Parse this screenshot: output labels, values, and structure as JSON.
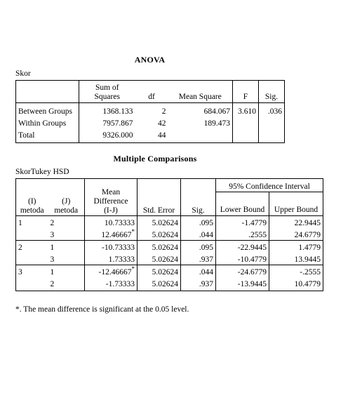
{
  "document": {
    "background": "#ffffff",
    "text_color": "#000000"
  },
  "anova": {
    "title": "ANOVA",
    "caption": "Skor",
    "columns": [
      "",
      "Sum of\nSquares",
      "df",
      "Mean Square",
      "F",
      "Sig."
    ],
    "column_labels": {
      "row_header": "",
      "sum_of_squares_line1": "Sum of",
      "sum_of_squares_line2": "Squares",
      "df": "df",
      "mean_square": "Mean Square",
      "f": "F",
      "sig": "Sig."
    },
    "rows": [
      {
        "source": "Between Groups",
        "sum_of_squares": "1368.133",
        "df": "2",
        "mean_square": "684.067",
        "f": "3.610",
        "sig": ".036"
      },
      {
        "source": "Within Groups",
        "sum_of_squares": "7957.867",
        "df": "42",
        "mean_square": "189.473",
        "f": "",
        "sig": ""
      },
      {
        "source": "Total",
        "sum_of_squares": "9326.000",
        "df": "44",
        "mean_square": "",
        "f": "",
        "sig": ""
      }
    ]
  },
  "multiple_comparisons": {
    "title": "Multiple Comparisons",
    "caption": "SkorTukey HSD",
    "headers": {
      "i_metoda_line1": "(I)",
      "i_metoda_line2": "metoda",
      "j_metoda_line1": "(J)",
      "j_metoda_line2": "metoda",
      "mean_difference_line1": "Mean",
      "mean_difference_line2": "Difference",
      "mean_difference_line3": "(I-J)",
      "std_error": "Std. Error",
      "sig": "Sig.",
      "confidence_interval": "95% Confidence Interval",
      "lower_bound": "Lower Bound",
      "upper_bound": "Upper Bound"
    },
    "groups": [
      {
        "i_metoda": "1",
        "rows": [
          {
            "j_metoda": "2",
            "mean_difference": "10.73333",
            "significant": false,
            "std_error": "5.02624",
            "sig": ".095",
            "lower_bound": "-1.4779",
            "upper_bound": "22.9445"
          },
          {
            "j_metoda": "3",
            "mean_difference": "12.46667",
            "significant": true,
            "std_error": "5.02624",
            "sig": ".044",
            "lower_bound": ".2555",
            "upper_bound": "24.6779"
          }
        ]
      },
      {
        "i_metoda": "2",
        "rows": [
          {
            "j_metoda": "1",
            "mean_difference": "-10.73333",
            "significant": false,
            "std_error": "5.02624",
            "sig": ".095",
            "lower_bound": "-22.9445",
            "upper_bound": "1.4779"
          },
          {
            "j_metoda": "3",
            "mean_difference": "1.73333",
            "significant": false,
            "std_error": "5.02624",
            "sig": ".937",
            "lower_bound": "-10.4779",
            "upper_bound": "13.9445"
          }
        ]
      },
      {
        "i_metoda": "3",
        "rows": [
          {
            "j_metoda": "1",
            "mean_difference": "-12.46667",
            "significant": true,
            "std_error": "5.02624",
            "sig": ".044",
            "lower_bound": "-24.6779",
            "upper_bound": "-.2555"
          },
          {
            "j_metoda": "2",
            "mean_difference": "-1.73333",
            "significant": false,
            "std_error": "5.02624",
            "sig": ".937",
            "lower_bound": "-13.9445",
            "upper_bound": "10.4779"
          }
        ]
      }
    ],
    "footnote": "*. The mean difference is significant at the 0.05 level."
  }
}
